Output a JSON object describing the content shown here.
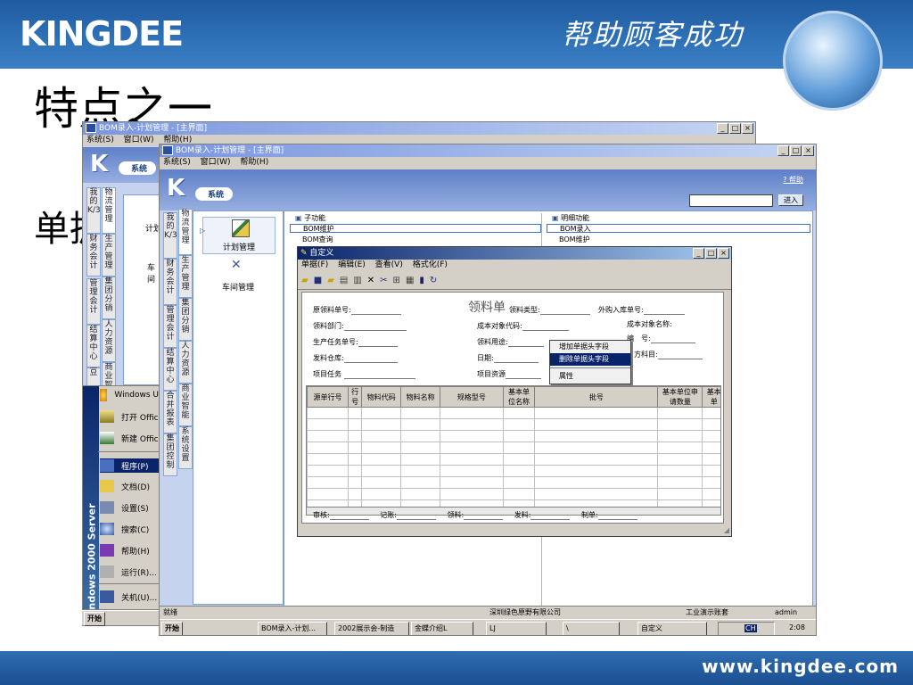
{
  "slide": {
    "logo": "KINGDEE",
    "slogan": "帮助顾客成功",
    "title": "特点之一",
    "subtext": "单据",
    "url": "www.kingdee.com"
  },
  "back_window": {
    "title": "BOM录入-计划管理 - [主界面]",
    "menu": [
      "系统(S)",
      "窗口(W)",
      "帮助(H)"
    ],
    "pill": "系统",
    "tabs": [
      "我的K/3",
      "物流管理",
      "生产管理",
      "财务会计",
      "管理会计",
      "集团分销",
      "人力资源",
      "结算中心",
      "商业智能",
      "豆"
    ],
    "tree_items": [
      "计划",
      "车间"
    ],
    "start_items": [
      "Windows U",
      "打开 Offic",
      "新建 Offic",
      "程序(P)",
      "文档(D)",
      "设置(S)",
      "搜索(C)",
      "帮助(H)",
      "运行(R)...",
      "关机(U)..."
    ],
    "start_banner": "Windows 2000 Server",
    "start_button": "开始"
  },
  "front_window": {
    "title": "BOM录入-计划管理 - [主界面]",
    "menu": [
      "系统(S)",
      "窗口(W)",
      "帮助(H)"
    ],
    "pill": "系统",
    "help_link": "? 帮助",
    "go_button": "进入",
    "tabs": [
      "我的K/3",
      "物流管理",
      "生产管理",
      "财务会计",
      "集团分销",
      "管理会计",
      "人力资源",
      "结算中心",
      "商业智能",
      "合并报表",
      "系统设置",
      "集团控制"
    ],
    "modules": [
      "计划管理",
      "车间管理"
    ],
    "subfunc_header": "子功能",
    "subfunc_items": [
      "BOM维护",
      "BOM查询"
    ],
    "detail_header": "明细功能",
    "detail_items": [
      "BOM录入",
      "BOM维护"
    ],
    "status_left": "就绪",
    "status_company": "深圳绿色原野有限公司",
    "status_account": "工业演示账套",
    "status_user": "admin"
  },
  "dialog": {
    "title": "自定义",
    "menu": [
      "单据(F)",
      "编辑(E)",
      "查看(V)",
      "格式化(F)"
    ],
    "doc_title": "领料单",
    "fields_left": [
      "原领料单号:",
      "领料部门:",
      "生产任务单号:",
      "发料仓库:",
      "项目任务"
    ],
    "fields_mid": [
      "领料类型:",
      "成本对象代码:",
      "领料用途:",
      "日期:",
      "项目资源"
    ],
    "fields_right": [
      "外购入库单号:",
      "成本对象名称:",
      "编　号:",
      "方科目:"
    ],
    "columns": [
      "源单行号",
      "行号",
      "物料代码",
      "物料名称",
      "规格型号",
      "基本单位名称",
      "批号",
      "基本单位申请数量",
      "基本单"
    ],
    "footer": [
      "审核:",
      "记账:",
      "领料:",
      "发料:",
      "制单:"
    ],
    "context_menu": [
      "增加单据头字段",
      "删除单据头字段",
      "属性"
    ],
    "context_selected_index": 1
  },
  "taskbar": {
    "start": "开始",
    "items": [
      "BOM录入-计划...",
      "2002展示会-制造",
      "金蝶介绍L",
      "LJ",
      "\\",
      "自定义"
    ],
    "clock": "2:08",
    "ime": "CH"
  }
}
